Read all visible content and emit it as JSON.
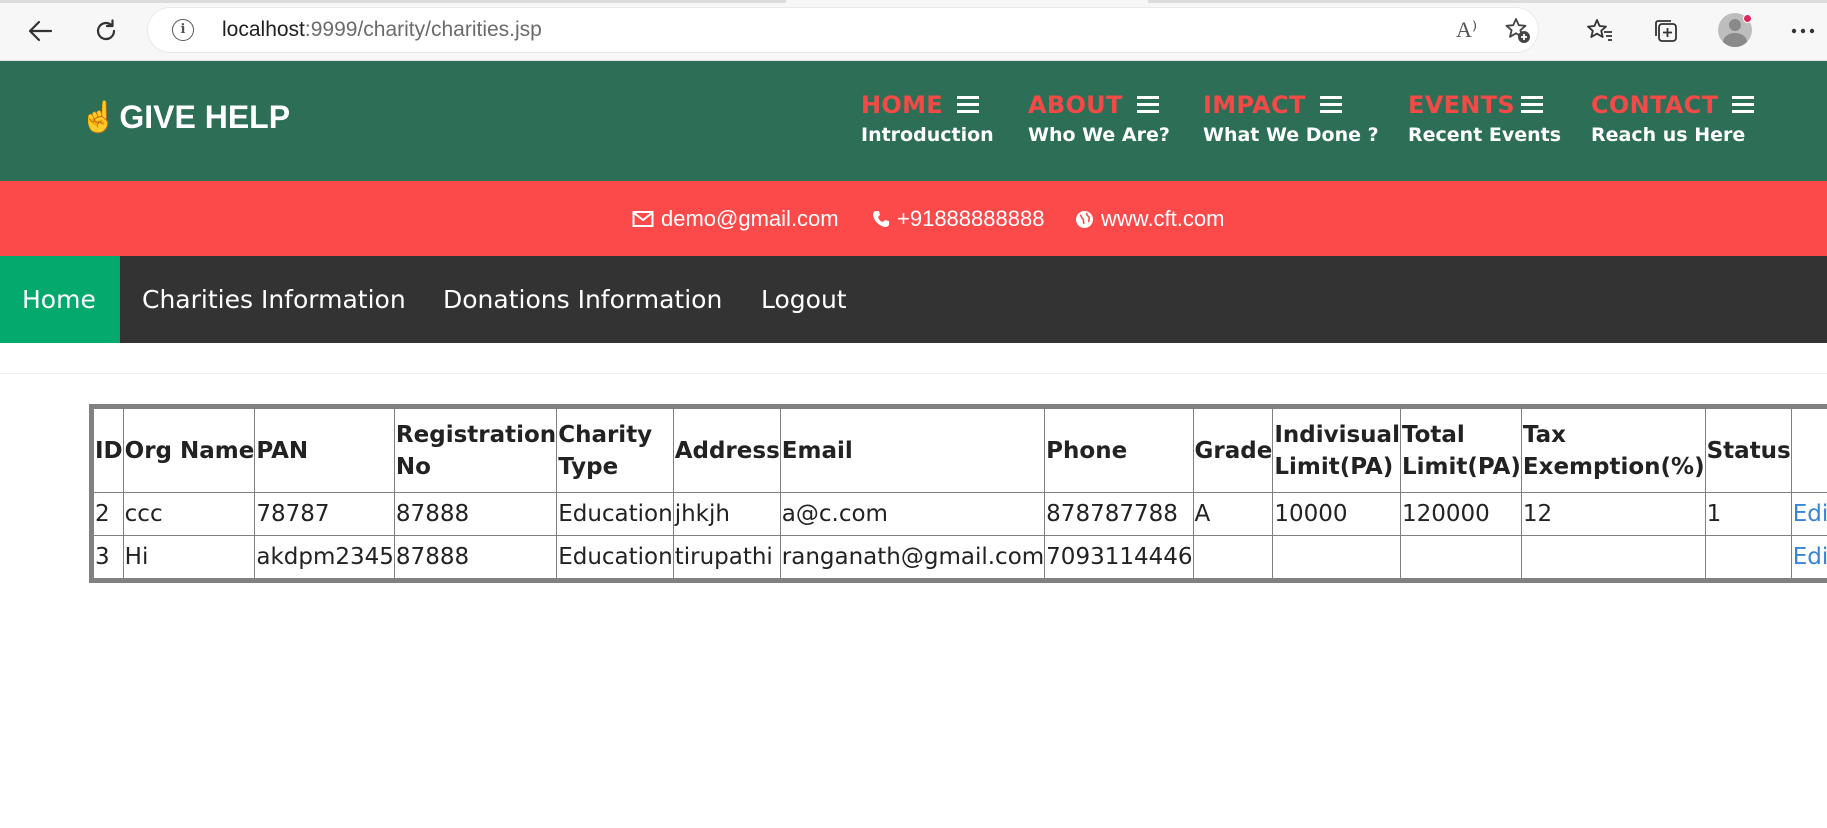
{
  "browser": {
    "url_host": "localhost",
    "url_rest": ":9999/charity/charities.jsp",
    "read_aloud_glyph": "A⁾"
  },
  "header": {
    "logo_text": "GIVE HELP",
    "logo_icon": "hand-pointing-up-icon",
    "nav": [
      {
        "title": "HOME",
        "sub": "Introduction"
      },
      {
        "title": "ABOUT",
        "sub": "Who We Are?"
      },
      {
        "title": "IMPACT",
        "sub": "What We Done ?"
      },
      {
        "title": "EVENTS",
        "sub": "Recent Events"
      },
      {
        "title": "CONTACT",
        "sub": "Reach us Here"
      }
    ]
  },
  "infobar": {
    "email": "demo@gmail.com",
    "phone": "+91888888888",
    "website": "www.cft.com"
  },
  "mainnav": {
    "items": [
      "Home",
      "Charities Information",
      "Donations Information",
      "Logout"
    ],
    "active": "Home"
  },
  "table": {
    "headers": [
      "ID",
      "Org Name",
      "PAN",
      "Registration No",
      "Charity Type",
      "Address",
      "Email",
      "Phone",
      "Grade",
      "Indivisual Limit(PA)",
      "Total Limit(PA)",
      "Tax Exemption(%)",
      "Status",
      ""
    ],
    "rows": [
      [
        "2",
        "ccc",
        "78787",
        "87888",
        "Education",
        "jhkjh",
        "a@c.com",
        "878787788",
        "A",
        "10000",
        "120000",
        "12",
        "1",
        "Edit"
      ],
      [
        "3",
        "Hi",
        "akdpm2345",
        "87888",
        "Education",
        "tirupathi",
        "ranganath@gmail.com",
        "7093114446",
        "",
        "",
        "",
        "",
        "",
        "Edit"
      ]
    ]
  },
  "colors": {
    "header_bg": "#2c6e56",
    "accent_red": "#fb4a49",
    "nav_bg": "#333333",
    "nav_active": "#04aa6d",
    "link": "#3a84d6"
  }
}
